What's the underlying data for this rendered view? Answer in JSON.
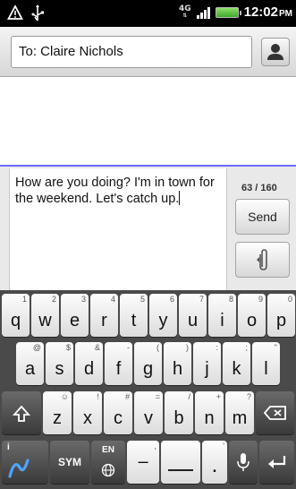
{
  "status_bar": {
    "network_type": "4G",
    "time": "12:02",
    "ampm": "PM"
  },
  "to_field": {
    "value": "To: Claire Nichols"
  },
  "compose": {
    "message_text": "How are you doing? I'm in town for the weekend. Let's catch up.",
    "char_count": "63 / 160",
    "send_label": "Send"
  },
  "keyboard": {
    "row1": [
      {
        "key": "q",
        "alt": "1"
      },
      {
        "key": "w",
        "alt": "2"
      },
      {
        "key": "e",
        "alt": "3"
      },
      {
        "key": "r",
        "alt": "4"
      },
      {
        "key": "t",
        "alt": "5"
      },
      {
        "key": "y",
        "alt": "6"
      },
      {
        "key": "u",
        "alt": "7"
      },
      {
        "key": "i",
        "alt": "8"
      },
      {
        "key": "o",
        "alt": "9"
      },
      {
        "key": "p",
        "alt": "0"
      }
    ],
    "row2": [
      {
        "key": "a",
        "alt": "@"
      },
      {
        "key": "s",
        "alt": "$"
      },
      {
        "key": "d",
        "alt": "&"
      },
      {
        "key": "f",
        "alt": "-"
      },
      {
        "key": "g",
        "alt": "("
      },
      {
        "key": "h",
        "alt": ")"
      },
      {
        "key": "j",
        "alt": ":"
      },
      {
        "key": "k",
        "alt": ";"
      },
      {
        "key": "l",
        "alt": "\""
      }
    ],
    "row3": [
      {
        "key": "z",
        "alt": "☺"
      },
      {
        "key": "x",
        "alt": "!"
      },
      {
        "key": "c",
        "alt": "#"
      },
      {
        "key": "v",
        "alt": "="
      },
      {
        "key": "b",
        "alt": "/"
      },
      {
        "key": "n",
        "alt": "+"
      },
      {
        "key": "m",
        "alt": "?"
      }
    ],
    "sym_label": "SYM",
    "lang_label": "EN",
    "dash_label": "–",
    "period_label": ".",
    "comma_alt": ",",
    "apostrophe_alt": "'",
    "info_label": "i"
  },
  "icons": {
    "alert": "warning-icon",
    "usb": "usb-icon",
    "signal": "signal-bars-icon",
    "battery": "battery-icon",
    "contact": "person-icon",
    "attach": "paperclip-icon",
    "shift": "shift-arrow-icon",
    "backspace": "backspace-icon",
    "globe": "globe-icon",
    "mic": "microphone-icon",
    "enter": "enter-arrow-icon",
    "swype": "swype-icon"
  }
}
